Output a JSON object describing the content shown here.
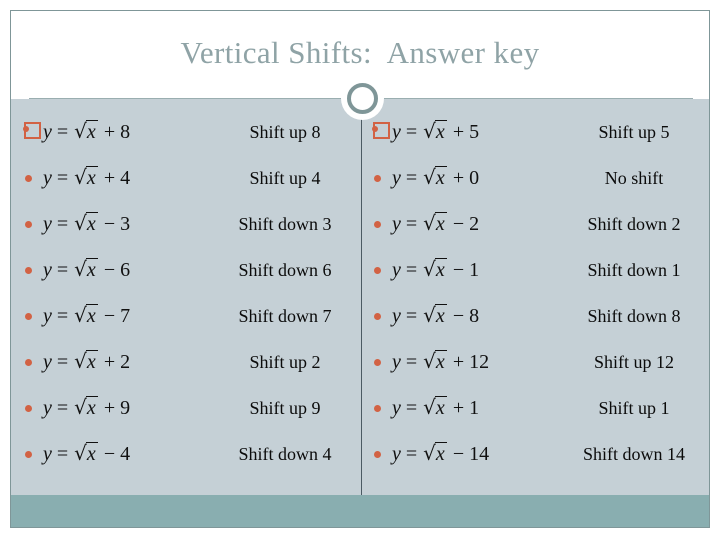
{
  "slide": {
    "title": "Vertical Shifts:  Answer key",
    "title_color": "#8fa3a6",
    "background_color": "#c5d0d6",
    "accent_bar_color": "#89aeb0",
    "bullet_color": "#d26244",
    "divider_color": "#4b5a63",
    "ring_color": "#7f9698"
  },
  "columns": [
    {
      "name": "left-column",
      "rows": [
        {
          "marked": true,
          "lhs": "y",
          "eq": "=",
          "radicand": "x",
          "op": "+",
          "value": "8",
          "answer": "Shift up 8"
        },
        {
          "marked": false,
          "lhs": "y",
          "eq": "=",
          "radicand": "x",
          "op": "+",
          "value": "4",
          "answer": "Shift up 4"
        },
        {
          "marked": false,
          "lhs": "y",
          "eq": "=",
          "radicand": "x",
          "op": "−",
          "value": "3",
          "answer": "Shift down 3"
        },
        {
          "marked": false,
          "lhs": "y",
          "eq": "=",
          "radicand": "x",
          "op": "−",
          "value": "6",
          "answer": "Shift down 6"
        },
        {
          "marked": false,
          "lhs": "y",
          "eq": "=",
          "radicand": "x",
          "op": "−",
          "value": "7",
          "answer": "Shift down 7"
        },
        {
          "marked": false,
          "lhs": "y",
          "eq": "=",
          "radicand": "x",
          "op": "+",
          "value": "2",
          "answer": "Shift up 2"
        },
        {
          "marked": false,
          "lhs": "y",
          "eq": "=",
          "radicand": "x",
          "op": "+",
          "value": "9",
          "answer": "Shift up 9"
        },
        {
          "marked": false,
          "lhs": "y",
          "eq": "=",
          "radicand": "x",
          "op": "−",
          "value": "4",
          "answer": "Shift down 4"
        }
      ]
    },
    {
      "name": "right-column",
      "rows": [
        {
          "marked": true,
          "lhs": "y",
          "eq": "=",
          "radicand": "x",
          "op": "+",
          "value": "5",
          "answer": "Shift up 5"
        },
        {
          "marked": false,
          "lhs": "y",
          "eq": "=",
          "radicand": "x",
          "op": "+",
          "value": "0",
          "answer": "No shift"
        },
        {
          "marked": false,
          "lhs": "y",
          "eq": "=",
          "radicand": "x",
          "op": "−",
          "value": "2",
          "answer": "Shift down 2"
        },
        {
          "marked": false,
          "lhs": "y",
          "eq": "=",
          "radicand": "x",
          "op": "−",
          "value": "1",
          "answer": "Shift down 1"
        },
        {
          "marked": false,
          "lhs": "y",
          "eq": "=",
          "radicand": "x",
          "op": "−",
          "value": "8",
          "answer": "Shift down 8"
        },
        {
          "marked": false,
          "lhs": "y",
          "eq": "=",
          "radicand": "x",
          "op": "+",
          "value": "12",
          "answer": "Shift up 12"
        },
        {
          "marked": false,
          "lhs": "y",
          "eq": "=",
          "radicand": "x",
          "op": "+",
          "value": "1",
          "answer": "Shift up 1"
        },
        {
          "marked": false,
          "lhs": "y",
          "eq": "=",
          "radicand": "x",
          "op": "−",
          "value": "14",
          "answer": "Shift down 14"
        }
      ]
    }
  ]
}
